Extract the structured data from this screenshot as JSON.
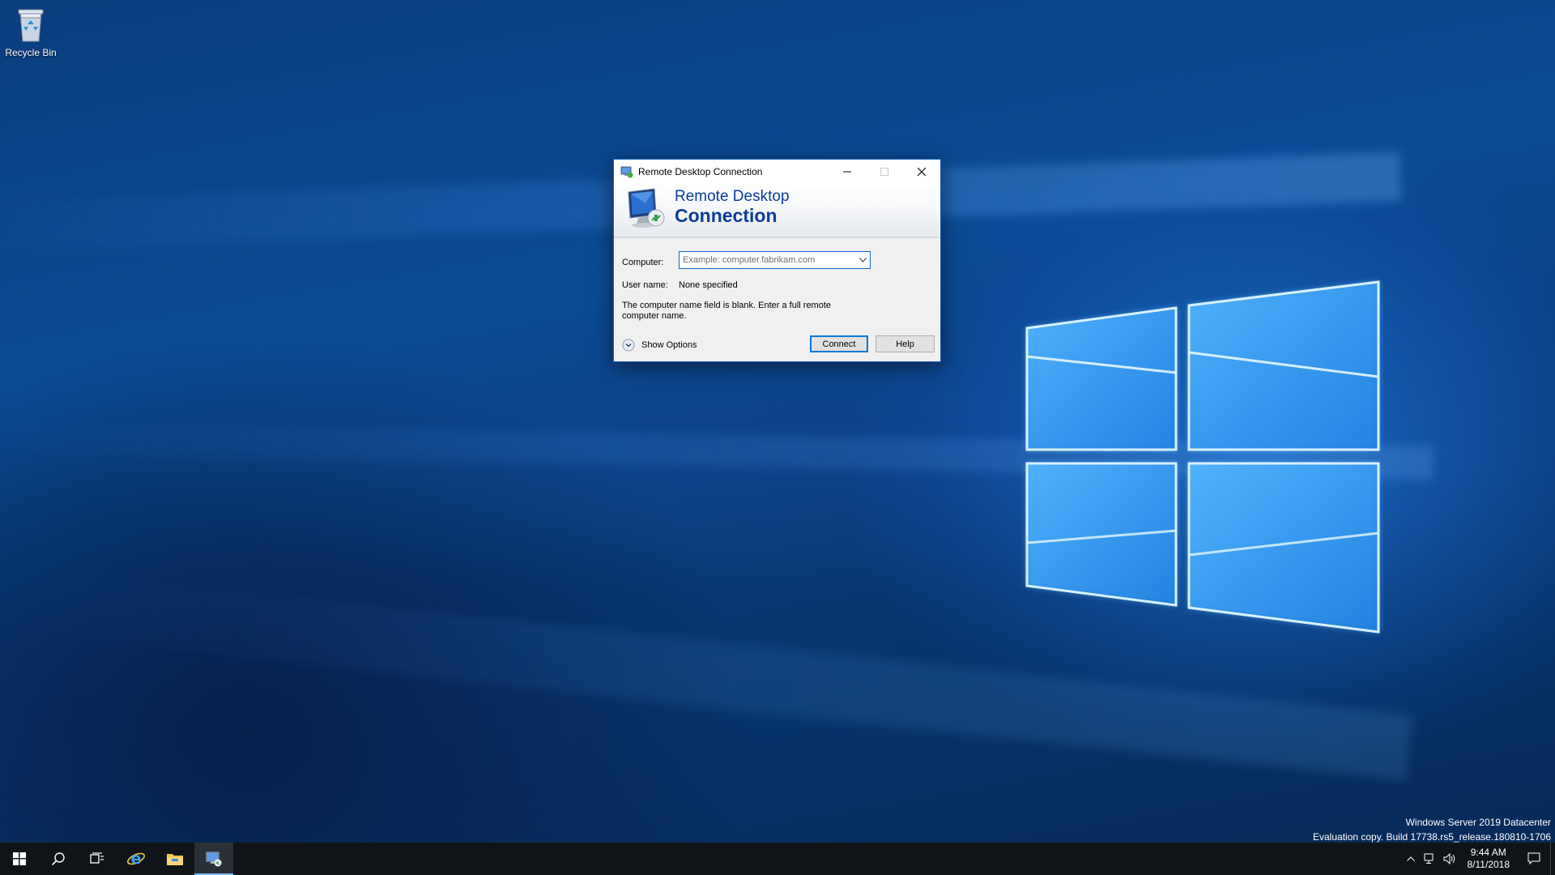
{
  "desktop": {
    "icons": [
      {
        "label": "Recycle Bin",
        "icon": "recycle-bin-icon"
      }
    ],
    "watermark": {
      "line1": "Windows Server 2019 Datacenter",
      "line2": "Evaluation copy. Build 17738.rs5_release.180810-1706"
    }
  },
  "dialog": {
    "window_title": "Remote Desktop Connection",
    "banner": {
      "line1": "Remote Desktop",
      "line2": "Connection"
    },
    "computer_label": "Computer:",
    "computer_placeholder": "Example: computer.fabrikam.com",
    "computer_value": "",
    "username_label": "User name:",
    "username_value": "None specified",
    "message": "The computer name field is blank. Enter a full remote computer name.",
    "show_options": "Show Options",
    "connect_label": "Connect",
    "help_label": "Help"
  },
  "taskbar": {
    "items": [
      "start-icon",
      "search-icon",
      "task-view-icon",
      "internet-explorer-icon",
      "file-explorer-icon",
      "remote-desktop-icon"
    ],
    "active_item": "remote-desktop-icon",
    "clock": {
      "time": "9:44 AM",
      "date": "8/11/2018"
    }
  },
  "colors": {
    "accent": "#0078d7",
    "banner_text": "#0b3d9a",
    "taskbar": "#101418"
  }
}
